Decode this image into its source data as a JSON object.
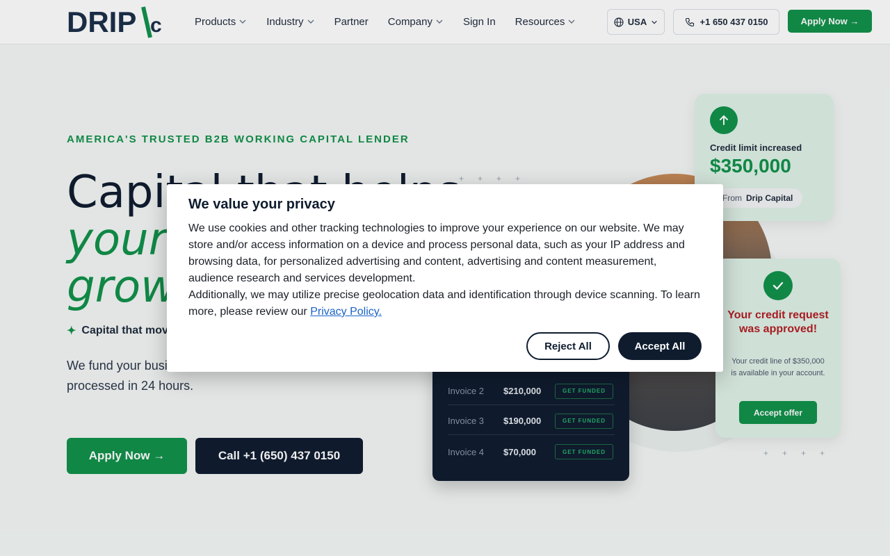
{
  "header": {
    "logo_text": "DRIP/c",
    "nav": [
      {
        "label": "Products",
        "has_dropdown": true
      },
      {
        "label": "Industry",
        "has_dropdown": true
      },
      {
        "label": "Partner",
        "has_dropdown": false
      },
      {
        "label": "Company",
        "has_dropdown": true
      },
      {
        "label": "Sign In",
        "has_dropdown": false
      },
      {
        "label": "Resources",
        "has_dropdown": true
      }
    ],
    "country": "USA",
    "phone": "+1 650 437 0150",
    "apply_label": "Apply Now →"
  },
  "hero": {
    "eyebrow": "AMERICA'S TRUSTED B2B WORKING CAPITAL LENDER",
    "line1": "Capital that helps",
    "line2": "your",
    "line3": "grow",
    "sparkle_text": "Capital that mov",
    "description": "We fund your busi within 48 hours, then transactions are processed in 24 hours.",
    "apply_label": "Apply Now →",
    "call_label": "Call +1 (650) 437 0150"
  },
  "credit_card": {
    "label": "Credit limit increased",
    "amount": "$350,000",
    "from_prefix": "From",
    "from_name": "Drip Capital"
  },
  "approved_card": {
    "title": "Your credit request was approved!",
    "body": "Your credit line of $350,000 is available in your account.",
    "button": "Accept offer"
  },
  "invoices": [
    {
      "name": "Invoice 2",
      "amount": "$210,000",
      "action": "GET FUNDED"
    },
    {
      "name": "Invoice 3",
      "amount": "$190,000",
      "action": "GET FUNDED"
    },
    {
      "name": "Invoice 4",
      "amount": "$70,000",
      "action": "GET FUNDED"
    }
  ],
  "cookie_modal": {
    "title": "We value your privacy",
    "paragraph1": "We use cookies and other tracking technologies to improve your experience on our website. We may store and/or access information on a device and process personal data, such as your IP address and browsing data, for personalized advertising and content, advertising and content measurement, audience research and services development.",
    "paragraph2": "Additionally, we may utilize precise geolocation data and identification through device scanning. To learn more, please review our",
    "policy_link": "Privacy Policy.",
    "reject_label": "Reject All",
    "accept_label": "Accept All"
  },
  "colors": {
    "brand_green": "#109148",
    "navy": "#0f1c2e",
    "alert_red": "#b31d22"
  },
  "icons": [
    "globe-icon",
    "phone-icon",
    "chevron-down-icon",
    "arrow-up-icon",
    "check-icon",
    "sparkle-icon"
  ]
}
